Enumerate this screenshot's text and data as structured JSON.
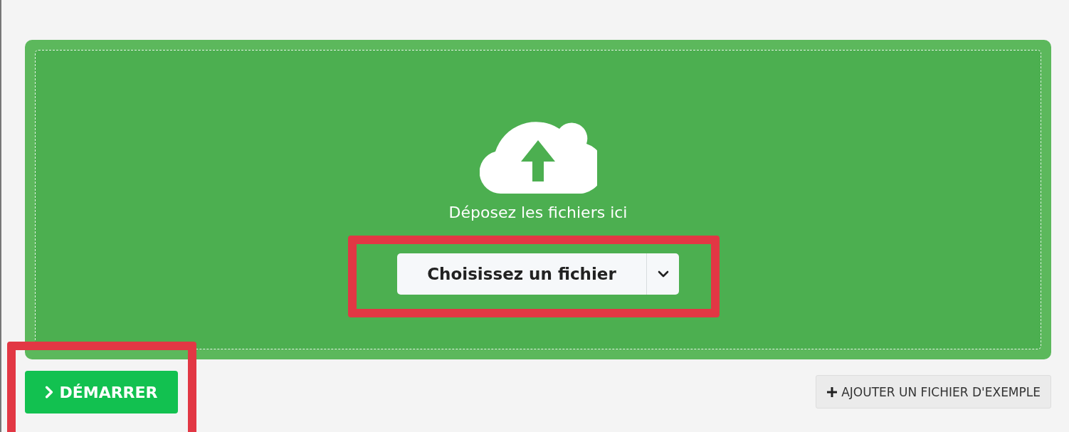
{
  "dropzone": {
    "prompt": "Déposez les fichiers ici",
    "picker": {
      "label": "Choisissez un fichier",
      "highlighted": true
    }
  },
  "actions": {
    "start": {
      "label": "DÉMARRER",
      "highlighted": true
    },
    "sample": {
      "label": "AJOUTER UN FICHIER D'EXEMPLE"
    }
  }
}
